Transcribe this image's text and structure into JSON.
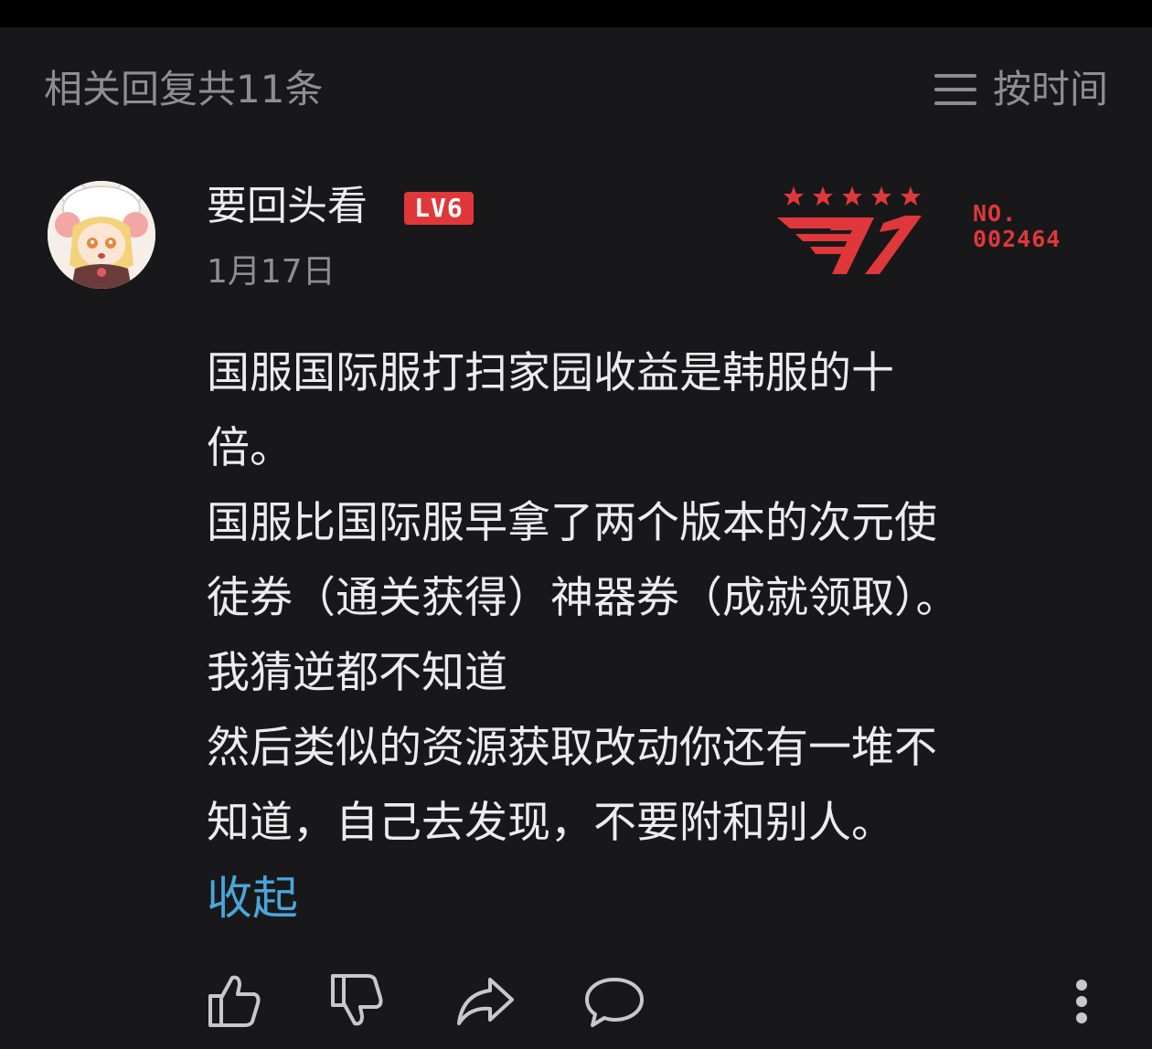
{
  "header": {
    "reply_count_text": "相关回复共11条",
    "sort_label": "按时间",
    "sort_icon": "menu-lines-icon"
  },
  "comment": {
    "username": "要回头看",
    "level": "LV6",
    "date": "1月17日",
    "badge": {
      "no_label": "NO.",
      "no_value": "002464",
      "color": "#e0383a"
    },
    "lines": [
      "国服国际服打扫家园收益是韩服的十",
      "倍。",
      "国服比国际服早拿了两个版本的次元使",
      "徒券（通关获得）神器券（成就领取）。",
      "我猜逆都不知道",
      "然后类似的资源获取改动你还有一堆不",
      "知道，自己去发现，不要附和别人。"
    ],
    "collapse_label": "收起"
  },
  "actions": {
    "icons": [
      "thumbs-up-icon",
      "thumbs-down-icon",
      "share-icon",
      "comment-icon",
      "more-vertical-icon"
    ]
  },
  "colors": {
    "background": "#18181a",
    "text_primary": "#ececee",
    "text_secondary": "#8e8e92",
    "link": "#4aa6dc",
    "accent_red": "#e0383a"
  }
}
